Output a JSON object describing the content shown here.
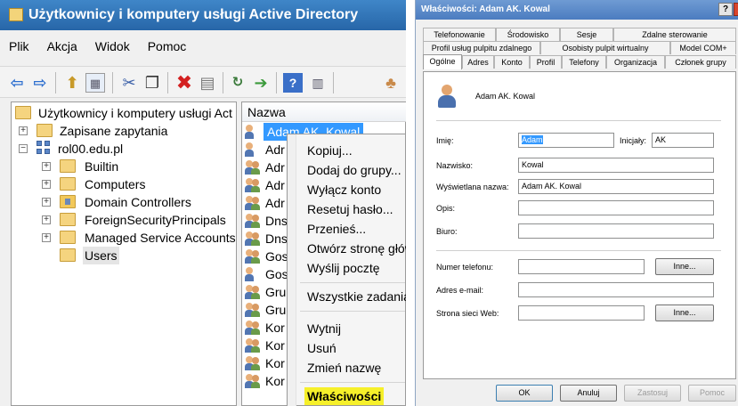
{
  "aduc": {
    "title": "Użytkownicy i komputery usługi Active Directory",
    "menu": [
      "Plik",
      "Akcja",
      "Widok",
      "Pomoc"
    ],
    "toolbar_icons": [
      "back-icon",
      "forward-icon",
      "up-folder-icon",
      "show-tree-icon",
      "cut-icon",
      "copy-icon",
      "delete-icon",
      "properties-icon",
      "refresh-icon",
      "export-icon",
      "help-icon",
      "view-icon",
      "new-user-icon"
    ],
    "tree": {
      "root": "Użytkownicy i komputery usługi Act",
      "saved_queries": "Zapisane zapytania",
      "domain": "rol00.edu.pl",
      "children": [
        "Builtin",
        "Computers",
        "Domain Controllers",
        "ForeignSecurityPrincipals",
        "Managed Service Accounts",
        "Users"
      ]
    },
    "list": {
      "column": "Nazwa",
      "rows": [
        "Adam AK. Kowal",
        "Adr",
        "Adr",
        "Adr",
        "Adr",
        "Dns",
        "Dns",
        "Gos",
        "Gos",
        "Gru",
        "Gru",
        "Kor",
        "Kor",
        "Kor",
        "Kor"
      ]
    },
    "context_menu": {
      "group1": [
        "Kopiuj...",
        "Dodaj do grupy...",
        "Wyłącz konto",
        "Resetuj hasło...",
        "Przenieś...",
        "Otwórz stronę główną",
        "Wyślij pocztę"
      ],
      "group2": [
        "Wszystkie zadania"
      ],
      "group3": [
        "Wytnij",
        "Usuń",
        "Zmień nazwę"
      ],
      "group4": [
        "Właściwości"
      ]
    }
  },
  "props": {
    "title": "Właściwości: Adam AK. Kowal",
    "title_buttons": [
      "?",
      "X"
    ],
    "tabs_row1": [
      "Telefonowanie",
      "Środowisko",
      "Sesje",
      "Zdalne sterowanie"
    ],
    "tabs_row2": [
      "Profil usług pulpitu zdalnego",
      "Osobisty pulpit wirtualny",
      "Model COM+"
    ],
    "tabs_row3": [
      "Ogólne",
      "Adres",
      "Konto",
      "Profil",
      "Telefony",
      "Organizacja",
      "Członek grupy"
    ],
    "display_header": "Adam AK. Kowal",
    "labels": {
      "first_name": "Imię:",
      "initials": "Inicjały:",
      "last_name": "Nazwisko:",
      "display_name": "Wyświetlana nazwa:",
      "description": "Opis:",
      "office": "Biuro:",
      "phone": "Numer telefonu:",
      "email": "Adres e-mail:",
      "web": "Strona sieci Web:"
    },
    "values": {
      "first_name": "Adam",
      "initials": "AK",
      "last_name": "Kowal",
      "display_name": "Adam AK. Kowal",
      "description": "",
      "office": "",
      "phone": "",
      "email": "",
      "web": ""
    },
    "other_button": "Inne...",
    "footer": [
      "OK",
      "Anuluj",
      "Zastosuj",
      "Pomoc"
    ]
  }
}
